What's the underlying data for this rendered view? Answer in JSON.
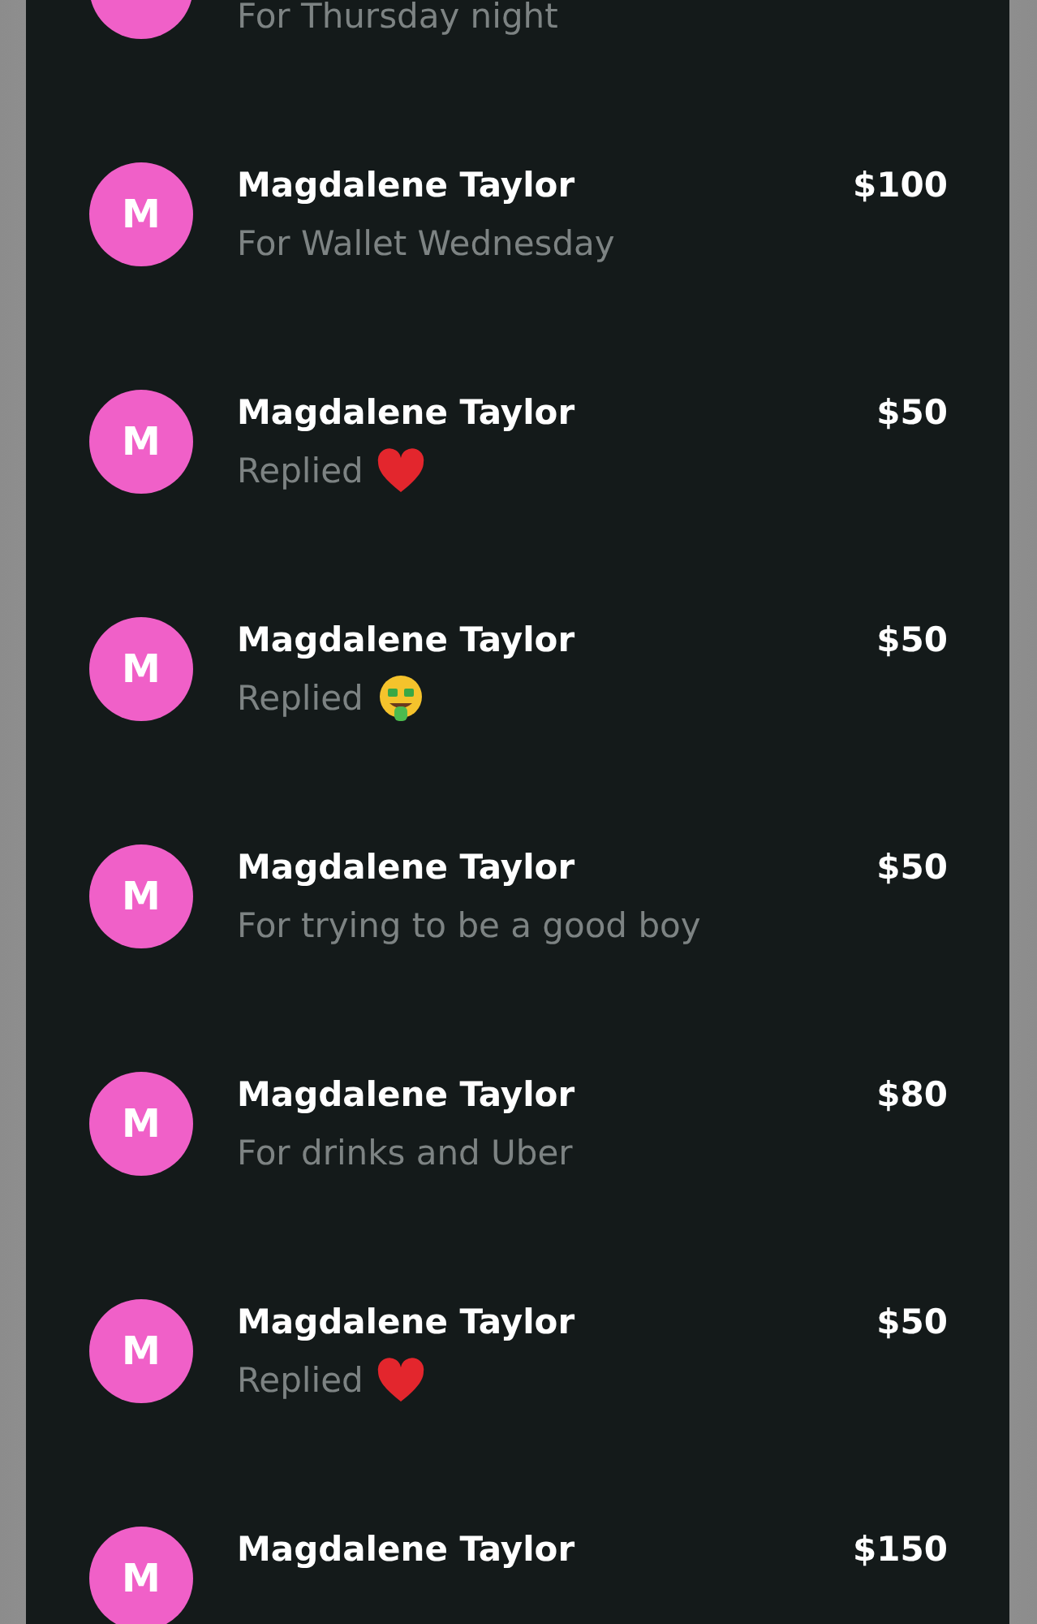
{
  "payments": [
    {
      "kind": "note",
      "subtitle": "For Thursday night"
    },
    {
      "kind": "note",
      "avatar": "M",
      "name": "Magdalene Taylor",
      "amount": "$100",
      "subtitle": "For Wallet Wednesday"
    },
    {
      "kind": "heart",
      "avatar": "M",
      "name": "Magdalene Taylor",
      "amount": "$50",
      "subtitle": "Replied"
    },
    {
      "kind": "money-face",
      "avatar": "M",
      "name": "Magdalene Taylor",
      "amount": "$50",
      "subtitle": "Replied"
    },
    {
      "kind": "note",
      "avatar": "M",
      "name": "Magdalene Taylor",
      "amount": "$50",
      "subtitle": "For trying to be a good boy"
    },
    {
      "kind": "note",
      "avatar": "M",
      "name": "Magdalene Taylor",
      "amount": "$80",
      "subtitle": "For drinks and Uber"
    },
    {
      "kind": "heart",
      "avatar": "M",
      "name": "Magdalene Taylor",
      "amount": "$50",
      "subtitle": "Replied"
    },
    {
      "kind": "note",
      "avatar": "M",
      "name": "Magdalene Taylor",
      "amount": "$150"
    }
  ]
}
